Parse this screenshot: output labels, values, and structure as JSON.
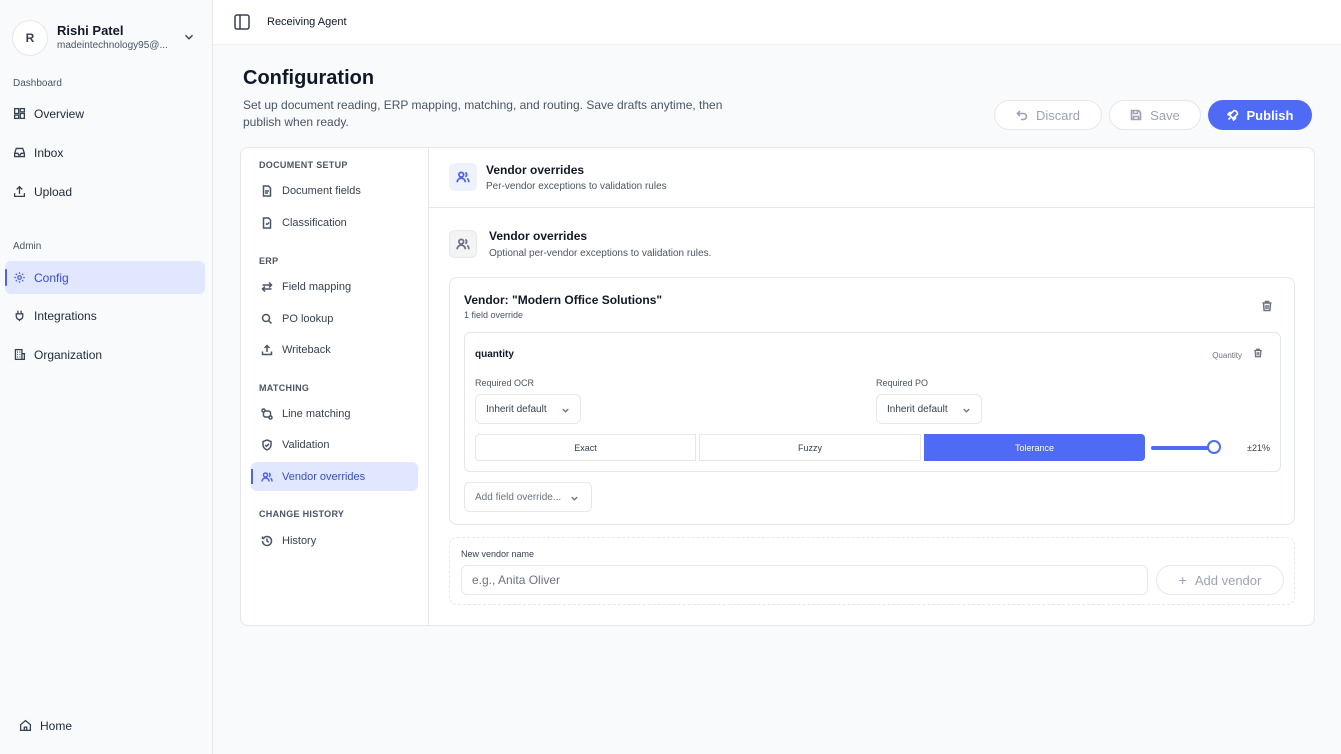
{
  "user": {
    "initial": "R",
    "name": "Rishi Patel",
    "email": "madeintechnology95@..."
  },
  "sidebar": {
    "dashboard_label": "Dashboard",
    "dashboard_items": [
      {
        "label": "Overview",
        "icon": "grid-icon"
      },
      {
        "label": "Inbox",
        "icon": "inbox-icon"
      },
      {
        "label": "Upload",
        "icon": "upload-icon"
      }
    ],
    "admin_label": "Admin",
    "admin_items": [
      {
        "label": "Config",
        "icon": "gear-icon",
        "active": true
      },
      {
        "label": "Integrations",
        "icon": "plug-icon"
      },
      {
        "label": "Organization",
        "icon": "building-icon"
      }
    ],
    "home_label": "Home"
  },
  "topbar": {
    "breadcrumb": "Receiving Agent"
  },
  "header": {
    "title": "Configuration",
    "description": "Set up document reading, ERP mapping, matching, and routing. Save drafts anytime, then publish when ready.",
    "discard_label": "Discard",
    "save_label": "Save",
    "publish_label": "Publish"
  },
  "subnav": {
    "sections": [
      {
        "label": "DOCUMENT SETUP",
        "items": [
          "Document fields",
          "Classification"
        ]
      },
      {
        "label": "ERP",
        "items": [
          "Field mapping",
          "PO lookup",
          "Writeback"
        ]
      },
      {
        "label": "MATCHING",
        "items": [
          "Line matching",
          "Validation",
          "Vendor overrides"
        ]
      },
      {
        "label": "CHANGE HISTORY",
        "items": [
          "History"
        ]
      }
    ],
    "active": "Vendor overrides"
  },
  "panel": {
    "title": "Vendor overrides",
    "subtitle": "Per-vendor exceptions to validation rules",
    "section_title": "Vendor overrides",
    "section_subtitle": "Optional per-vendor exceptions to validation rules."
  },
  "vendor": {
    "title": "Vendor: \"Modern Office Solutions\"",
    "count": "1 field override",
    "field": {
      "name": "quantity",
      "type": "Quantity",
      "required_ocr_label": "Required OCR",
      "required_ocr_value": "Inherit default",
      "required_po_label": "Required PO",
      "required_po_value": "Inherit default",
      "modes": [
        "Exact",
        "Fuzzy",
        "Tolerance"
      ],
      "active_mode": "Tolerance",
      "tolerance_fraction": 0.9,
      "tolerance_label": "±21%"
    },
    "add_field_label": "Add field override..."
  },
  "new_vendor": {
    "label": "New vendor name",
    "placeholder": "e.g., Anita Oliver",
    "add_label": "Add vendor"
  },
  "colors": {
    "accent": "#4f6af5",
    "active_bg": "#e0e7ff"
  }
}
